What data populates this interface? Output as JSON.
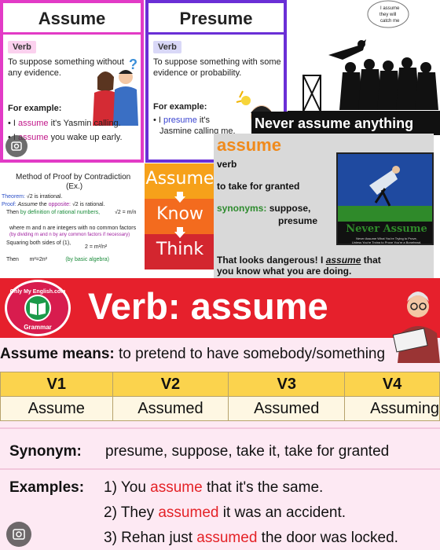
{
  "tile_assume": {
    "title": "Assume",
    "tag": "Verb",
    "definition_1": "To suppose something without",
    "definition_2": "any evidence.",
    "example_heading": "For example:",
    "ex1_pre": "• I ",
    "ex1_hl": "assume",
    "ex1_post": " it's Yasmin calling.",
    "ex2_pre": "• I ",
    "ex2_hl": "assume",
    "ex2_post": " you wake up early."
  },
  "tile_presume": {
    "title": "Presume",
    "tag": "Verb",
    "definition_1": "To suppose something with some",
    "definition_2": "evidence or probability.",
    "example_heading": "For example:",
    "ex1_pre": "• I ",
    "ex1_hl": "presume",
    "ex1_post": " it's",
    "ex1_line2": "Jasmine calling me."
  },
  "cartoon": {
    "bubble": "I assume they will catch me"
  },
  "never_banner": "Never assume anything",
  "proof": {
    "title": "Method of Proof by Contradiction",
    "subtitle": "(Ex.)",
    "l1a": "Theorem:",
    "l1b": "√2 is irrational.",
    "l2a": "Proof:",
    "l2b": "Assume",
    "l2c": "the",
    "l2d": "opposite:",
    "l2e": "√2 is rational.",
    "l3a": "Then",
    "l3b": "by definition of rational numbers,",
    "l3c": "√2 = m/n",
    "l4": "where m and n are integers with no common factors",
    "l5": "(by dividing m and n by any common factors if necessary)",
    "l6": "Squaring both sides of (1),",
    "l6b": "2 = m²/n²",
    "l7a": "Then",
    "l7b": "m²=2n²",
    "l7c": "(by basic algebra)"
  },
  "akt": {
    "w1": "Assume",
    "w2": "Know",
    "w3": "Think"
  },
  "dict": {
    "word": "assume",
    "pos": "verb",
    "definition": "to take for granted",
    "syn_label": "synonyms:",
    "syn_1": "suppose,",
    "syn_2": "presume",
    "quote_1": "That looks dangerous! I",
    "quote_hl": "assume",
    "quote_2": "that",
    "quote_3": "you know what you are doing.",
    "photo_title": "Never Assume",
    "photo_caption_1": "Never Assume What You're Trying to Prove,",
    "photo_caption_2": "Unless You're Trying to Prove You're a Bonehead."
  },
  "main": {
    "logo_top": "Only My English.com",
    "logo_bottom": "Grammar",
    "banner_title": "Verb: assume",
    "means_label": "Assume means:",
    "means_text": " to pretend to have somebody/something",
    "table": {
      "headers": [
        "V1",
        "V2",
        "V3",
        "V4"
      ],
      "cells": [
        "Assume",
        "Assumed",
        "Assumed",
        "Assuming"
      ]
    },
    "synonym_label": "Synonym:",
    "synonym_text": "presume, suppose, take it, take for granted",
    "examples_label": "Examples:",
    "examples": [
      {
        "pre": "1) You ",
        "hl": "assume",
        "post": " that it's the same."
      },
      {
        "pre": "2) They ",
        "hl": "assumed",
        "post": " it was an accident."
      },
      {
        "pre": "3) Rehan just ",
        "hl": "assumed",
        "post": " the door was locked."
      }
    ]
  },
  "colors": {
    "assume_border": "#e23bc6",
    "presume_border": "#6a2fd6",
    "banner_red": "#e6202c",
    "table_header": "#fbd34d",
    "highlight_red": "#e42227"
  }
}
